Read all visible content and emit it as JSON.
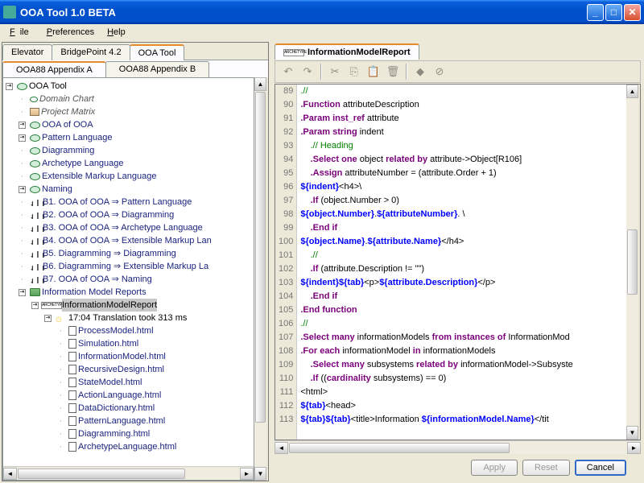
{
  "window": {
    "title": "OOA Tool 1.0 BETA"
  },
  "menu": {
    "file": "File",
    "prefs": "Preferences",
    "help": "Help"
  },
  "tabs": {
    "t1": "Elevator",
    "t2": "BridgePoint 4.2",
    "t3": "OOA Tool"
  },
  "subtabs": {
    "s1": "OOA88 Appendix A",
    "s2": "OOA88 Appendix B"
  },
  "tree": {
    "root": "OOA Tool",
    "domainChart": "Domain Chart",
    "projectMatrix": "Project Matrix",
    "ooaOfOoa": "OOA of OOA",
    "patternLang": "Pattern Language",
    "diagramming": "Diagramming",
    "archLang": "Archetype Language",
    "extMarkup": "Extensible Markup Language",
    "naming": "Naming",
    "b1": "B1. OOA of OOA ⇒ Pattern Language",
    "b2": "B2. OOA of OOA ⇒ Diagramming",
    "b3": "B3. OOA of OOA ⇒ Archetype Language",
    "b4": "B4. OOA of OOA ⇒ Extensible Markup Lan",
    "b5": "B5. Diagramming ⇒ Diagramming",
    "b6": "B6. Diagramming ⇒ Extensible Markup La",
    "b7": "B7. OOA of OOA ⇒ Naming",
    "reports": "Information Model Reports",
    "imr": "InformationModelReport",
    "trans": "17:04 Translation took 313 ms",
    "f1": "ProcessModel.html",
    "f2": "Simulation.html",
    "f3": "InformationModel.html",
    "f4": "RecursiveDesign.html",
    "f5": "StateModel.html",
    "f6": "ActionLanguage.html",
    "f7": "DataDictionary.html",
    "f8": "PatternLanguage.html",
    "f9": "Diagramming.html",
    "f10": "ArchetypeLanguage.html"
  },
  "editorTab": "InformationModelReport",
  "lineStart": 89,
  "code": [
    [
      {
        "t": ".//",
        "c": "com"
      }
    ],
    [
      {
        "t": ".",
        "c": "kw2"
      },
      {
        "t": "Function",
        "c": "kw2"
      },
      {
        "t": " attributeDescription"
      }
    ],
    [
      {
        "t": ".",
        "c": "kw2"
      },
      {
        "t": "Param inst_ref",
        "c": "kw2"
      },
      {
        "t": " attribute"
      }
    ],
    [
      {
        "t": ".",
        "c": "kw2"
      },
      {
        "t": "Param string",
        "c": "kw2"
      },
      {
        "t": " indent"
      }
    ],
    [
      {
        "t": "    "
      },
      {
        "t": ".// Heading",
        "c": "com"
      }
    ],
    [
      {
        "t": "    "
      },
      {
        "t": ".",
        "c": "kw2"
      },
      {
        "t": "Select one",
        "c": "kw2"
      },
      {
        "t": " object "
      },
      {
        "t": "related by",
        "c": "kw2"
      },
      {
        "t": " attribute->Object[R106]"
      }
    ],
    [
      {
        "t": "    "
      },
      {
        "t": ".",
        "c": "kw2"
      },
      {
        "t": "Assign",
        "c": "kw2"
      },
      {
        "t": " attributeNumber = (attribute.Order + 1)"
      }
    ],
    [
      {
        "t": "${indent}",
        "c": "kw"
      },
      {
        "t": "<h4>\\"
      }
    ],
    [
      {
        "t": "    "
      },
      {
        "t": ".",
        "c": "kw2"
      },
      {
        "t": "If",
        "c": "kw2"
      },
      {
        "t": " (object.Number > 0)"
      }
    ],
    [
      {
        "t": "${object.Number}",
        "c": "kw"
      },
      {
        "t": "."
      },
      {
        "t": "${attributeNumber}",
        "c": "kw"
      },
      {
        "t": ". \\"
      }
    ],
    [
      {
        "t": "    "
      },
      {
        "t": ".",
        "c": "kw2"
      },
      {
        "t": "End if",
        "c": "kw2"
      }
    ],
    [
      {
        "t": "${object.Name}",
        "c": "kw"
      },
      {
        "t": "."
      },
      {
        "t": "${attribute.Name}",
        "c": "kw"
      },
      {
        "t": "</h4>"
      }
    ],
    [
      {
        "t": "    "
      },
      {
        "t": ".//",
        "c": "com"
      }
    ],
    [
      {
        "t": "    "
      },
      {
        "t": ".",
        "c": "kw2"
      },
      {
        "t": "If",
        "c": "kw2"
      },
      {
        "t": " (attribute.Description != \"\")"
      }
    ],
    [
      {
        "t": "${indent}${tab}",
        "c": "kw"
      },
      {
        "t": "<p>"
      },
      {
        "t": "${attribute.Description}",
        "c": "kw"
      },
      {
        "t": "</p>"
      }
    ],
    [
      {
        "t": "    "
      },
      {
        "t": ".",
        "c": "kw2"
      },
      {
        "t": "End if",
        "c": "kw2"
      }
    ],
    [
      {
        "t": ".",
        "c": "kw2"
      },
      {
        "t": "End function",
        "c": "kw2"
      }
    ],
    [
      {
        "t": ".//",
        "c": "com"
      }
    ],
    [
      {
        "t": ".",
        "c": "kw2"
      },
      {
        "t": "Select many",
        "c": "kw2"
      },
      {
        "t": " informationModels "
      },
      {
        "t": "from instances of",
        "c": "kw2"
      },
      {
        "t": " InformationMod"
      }
    ],
    [
      {
        "t": ".",
        "c": "kw2"
      },
      {
        "t": "For each",
        "c": "kw2"
      },
      {
        "t": " informationModel "
      },
      {
        "t": "in",
        "c": "kw2"
      },
      {
        "t": " informationModels"
      }
    ],
    [
      {
        "t": "    "
      },
      {
        "t": ".",
        "c": "kw2"
      },
      {
        "t": "Select many",
        "c": "kw2"
      },
      {
        "t": " subsystems "
      },
      {
        "t": "related by",
        "c": "kw2"
      },
      {
        "t": " informationModel->Subsyste"
      }
    ],
    [
      {
        "t": "    "
      },
      {
        "t": ".",
        "c": "kw2"
      },
      {
        "t": "If",
        "c": "kw2"
      },
      {
        "t": " (("
      },
      {
        "t": "cardinality",
        "c": "kw2"
      },
      {
        "t": " subsystems) == 0)"
      }
    ],
    [
      {
        "t": "<html>"
      }
    ],
    [
      {
        "t": "${tab}",
        "c": "kw"
      },
      {
        "t": "<head>"
      }
    ],
    [
      {
        "t": "${tab}${tab}",
        "c": "kw"
      },
      {
        "t": "<title>Information "
      },
      {
        "t": "${informationModel.Name}",
        "c": "kw"
      },
      {
        "t": "</tit"
      }
    ]
  ],
  "buttons": {
    "apply": "Apply",
    "reset": "Reset",
    "cancel": "Cancel"
  }
}
